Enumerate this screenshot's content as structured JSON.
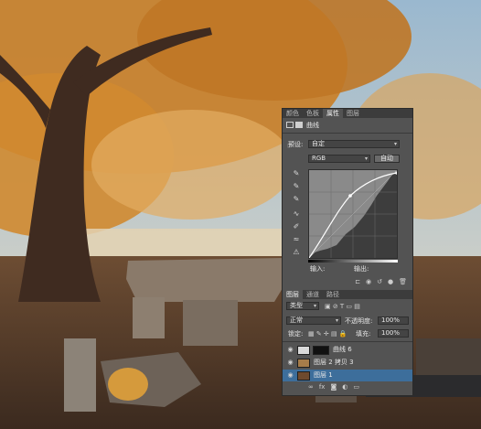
{
  "panel": {
    "tabs": [
      "颜色",
      "色板",
      "属性",
      "图层"
    ],
    "active_tab": "属性",
    "adjust_title": "曲线",
    "preset_label": "预设:",
    "preset_value": "自定",
    "channel_value": "RGB",
    "auto_button": "自动",
    "input_label": "输入:",
    "output_label": "输出:"
  },
  "layers": {
    "tabs": [
      "图层",
      "通道",
      "路径"
    ],
    "filter_kind": "类型",
    "blend_mode": "正常",
    "opacity_label": "不透明度:",
    "opacity_value": "100%",
    "lock_label": "锁定:",
    "fill_label": "填充:",
    "fill_value": "100%",
    "items": [
      {
        "name": "曲线 6",
        "thumb": "curves-adjustment"
      },
      {
        "name": "图层 2 拷贝 3",
        "thumb": "texture"
      },
      {
        "name": "图层 1",
        "thumb": "photo"
      }
    ]
  },
  "colors": {
    "panel_bg": "#535353",
    "panel_dark": "#3c3c3c",
    "selected_layer": "#3d6e9b",
    "curve_line": "#ffffff"
  }
}
